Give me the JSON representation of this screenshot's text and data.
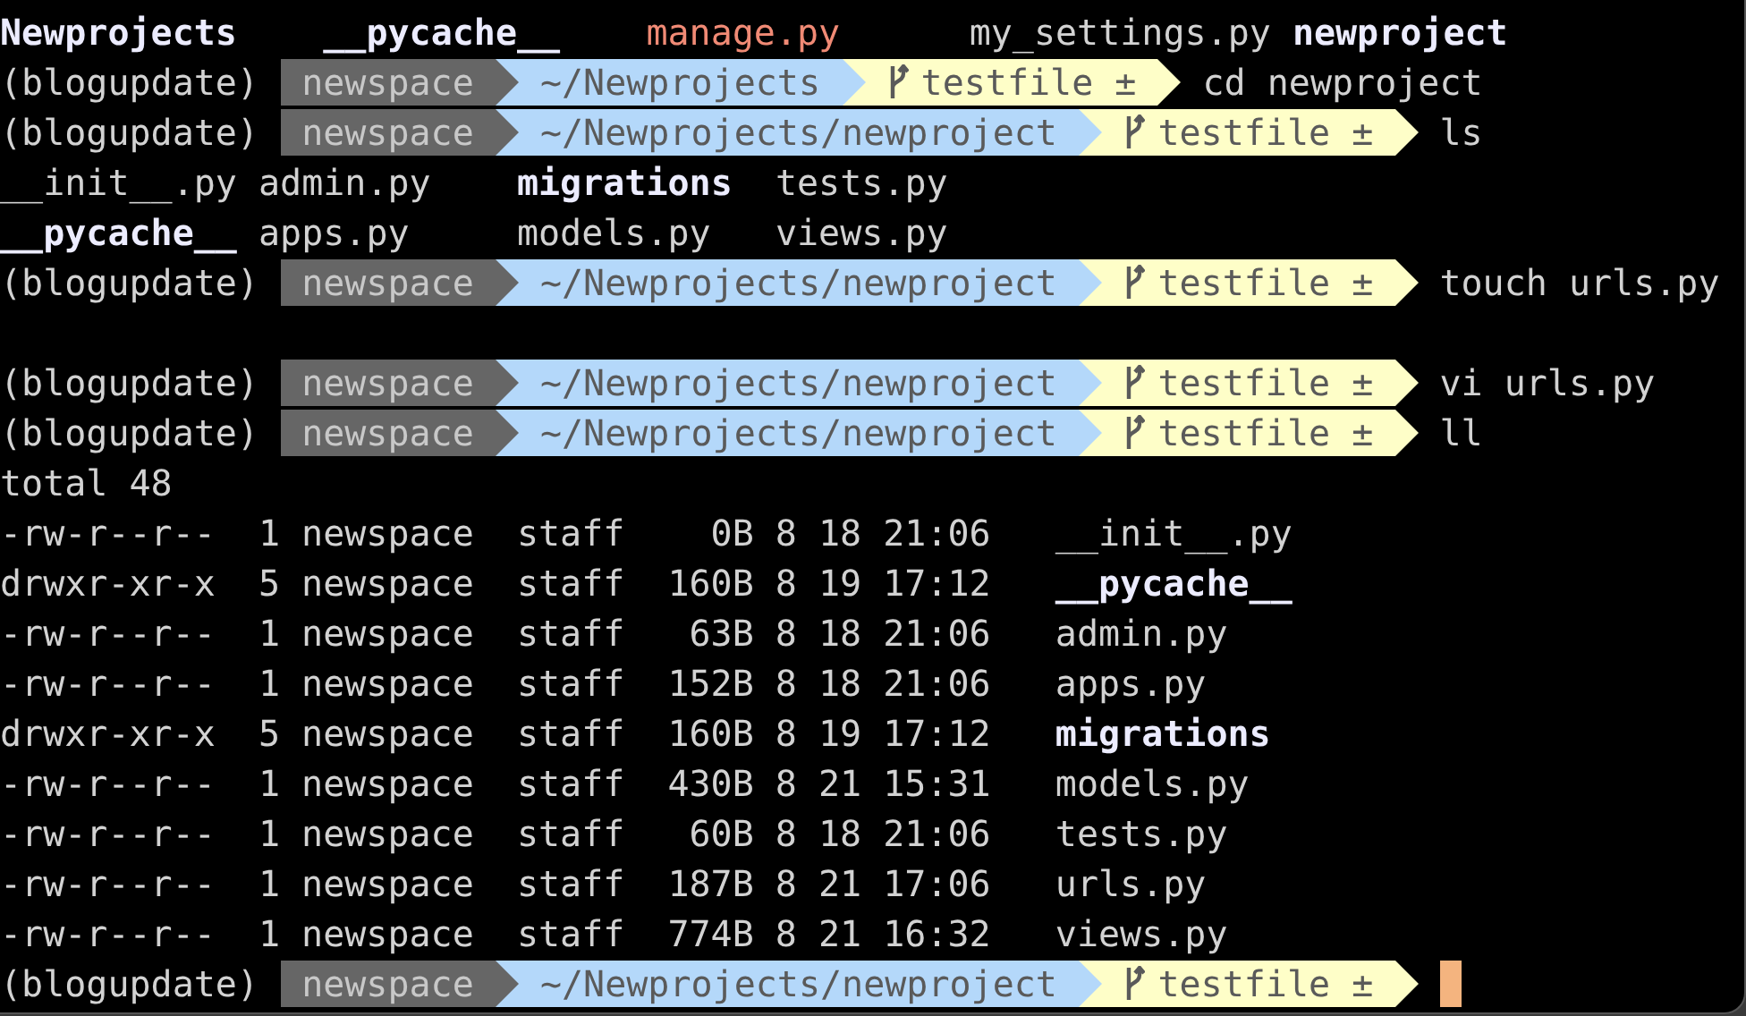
{
  "lines": [
    {
      "kind": "listing",
      "rows": [
        [
          {
            "name": "Newprojects",
            "kind": "dir"
          },
          {
            "name": "__pycache__",
            "kind": "dir"
          },
          {
            "name": "manage.py",
            "kind": "exec"
          },
          {
            "name": "my_settings.py",
            "kind": "file"
          },
          {
            "name": "newproject",
            "kind": "dir"
          }
        ]
      ]
    },
    {
      "kind": "prompt",
      "env": "(blogupdate)",
      "user": "newspace",
      "path": "~/Newprojects",
      "branch": "testfile ±",
      "command": "cd newproject"
    },
    {
      "kind": "prompt",
      "env": "(blogupdate)",
      "user": "newspace",
      "path": "~/Newprojects/newproject",
      "branch": "testfile ±",
      "command": "ls"
    },
    {
      "kind": "listing",
      "rows": [
        [
          {
            "name": "__init__.py",
            "kind": "file"
          },
          {
            "name": "admin.py",
            "kind": "file"
          },
          {
            "name": "migrations",
            "kind": "dir"
          },
          {
            "name": "tests.py",
            "kind": "file"
          }
        ],
        [
          {
            "name": "__pycache__",
            "kind": "dir"
          },
          {
            "name": "apps.py",
            "kind": "file"
          },
          {
            "name": "models.py",
            "kind": "file"
          },
          {
            "name": "views.py",
            "kind": "file"
          }
        ]
      ]
    },
    {
      "kind": "prompt",
      "env": "(blogupdate)",
      "user": "newspace",
      "path": "~/Newprojects/newproject",
      "branch": "testfile ±",
      "command": "touch urls.py"
    },
    {
      "kind": "blank"
    },
    {
      "kind": "prompt",
      "env": "(blogupdate)",
      "user": "newspace",
      "path": "~/Newprojects/newproject",
      "branch": "testfile ±",
      "command": "vi urls.py"
    },
    {
      "kind": "prompt",
      "env": "(blogupdate)",
      "user": "newspace",
      "path": "~/Newprojects/newproject",
      "branch": "testfile ±",
      "command": "ll"
    },
    {
      "kind": "text",
      "text": "total 48"
    },
    {
      "kind": "long_listing",
      "rows": [
        {
          "perms": "-rw-r--r--",
          "links": "1",
          "owner": "newspace",
          "group": "staff",
          "size": "0B",
          "month": "8",
          "day": "18",
          "time": "21:06",
          "name": "__init__.py",
          "kind": "file"
        },
        {
          "perms": "drwxr-xr-x",
          "links": "5",
          "owner": "newspace",
          "group": "staff",
          "size": "160B",
          "month": "8",
          "day": "19",
          "time": "17:12",
          "name": "__pycache__",
          "kind": "dir"
        },
        {
          "perms": "-rw-r--r--",
          "links": "1",
          "owner": "newspace",
          "group": "staff",
          "size": "63B",
          "month": "8",
          "day": "18",
          "time": "21:06",
          "name": "admin.py",
          "kind": "file"
        },
        {
          "perms": "-rw-r--r--",
          "links": "1",
          "owner": "newspace",
          "group": "staff",
          "size": "152B",
          "month": "8",
          "day": "18",
          "time": "21:06",
          "name": "apps.py",
          "kind": "file"
        },
        {
          "perms": "drwxr-xr-x",
          "links": "5",
          "owner": "newspace",
          "group": "staff",
          "size": "160B",
          "month": "8",
          "day": "19",
          "time": "17:12",
          "name": "migrations",
          "kind": "dir"
        },
        {
          "perms": "-rw-r--r--",
          "links": "1",
          "owner": "newspace",
          "group": "staff",
          "size": "430B",
          "month": "8",
          "day": "21",
          "time": "15:31",
          "name": "models.py",
          "kind": "file"
        },
        {
          "perms": "-rw-r--r--",
          "links": "1",
          "owner": "newspace",
          "group": "staff",
          "size": "60B",
          "month": "8",
          "day": "18",
          "time": "21:06",
          "name": "tests.py",
          "kind": "file"
        },
        {
          "perms": "-rw-r--r--",
          "links": "1",
          "owner": "newspace",
          "group": "staff",
          "size": "187B",
          "month": "8",
          "day": "21",
          "time": "17:06",
          "name": "urls.py",
          "kind": "file"
        },
        {
          "perms": "-rw-r--r--",
          "links": "1",
          "owner": "newspace",
          "group": "staff",
          "size": "774B",
          "month": "8",
          "day": "21",
          "time": "16:32",
          "name": "views.py",
          "kind": "file"
        }
      ]
    },
    {
      "kind": "prompt",
      "env": "(blogupdate)",
      "user": "newspace",
      "path": "~/Newprojects/newproject",
      "branch": "testfile ±",
      "cursor": true
    }
  ]
}
